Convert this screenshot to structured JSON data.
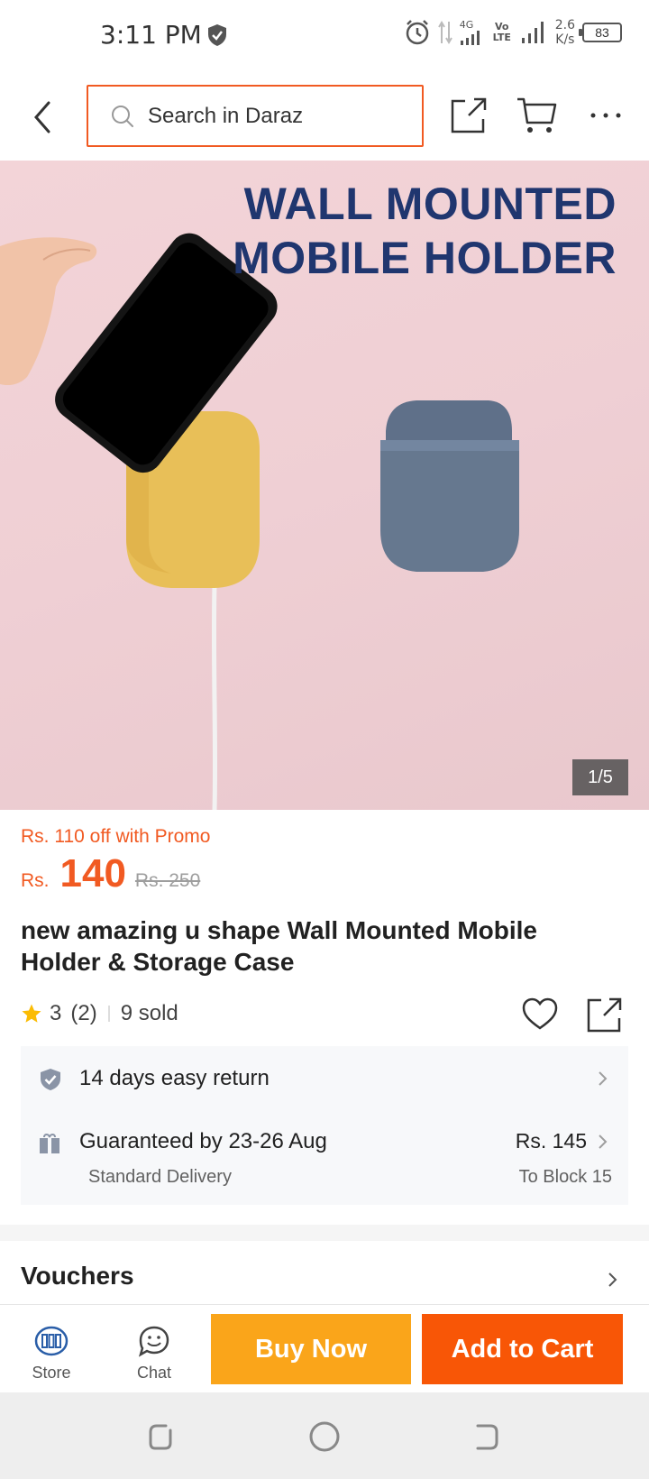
{
  "status_bar": {
    "time": "3:11 PM",
    "network_4g": "4G",
    "volte": "Vo LTE",
    "speed_value": "2.6",
    "speed_unit": "K/s",
    "battery": "83"
  },
  "header": {
    "search_placeholder": "Search in Daraz"
  },
  "product_image": {
    "title_line1": "WALL MOUNTED",
    "title_line2": "MOBILE HOLDER",
    "counter": "1/5"
  },
  "price": {
    "promo": "Rs. 110 off with Promo",
    "currency": "Rs.",
    "current": "140",
    "original": "Rs. 250",
    "accent_color": "#f15a22"
  },
  "product": {
    "title": "new amazing u shape Wall Mounted Mobile Holder & Storage Case",
    "rating": "3",
    "rating_count": "(2)",
    "sold": "9 sold"
  },
  "delivery": {
    "return_text": "14 days easy return",
    "guarantee_text": "Guaranteed by 23-26 Aug",
    "delivery_type": "Standard Delivery",
    "fee": "Rs. 145",
    "area": "To Block 15"
  },
  "vouchers": {
    "label": "Vouchers"
  },
  "action_bar": {
    "store_label": "Store",
    "chat_label": "Chat",
    "buy_now": "Buy Now",
    "add_to_cart": "Add to Cart",
    "buy_color": "#faa51a",
    "cart_color": "#f85606"
  }
}
